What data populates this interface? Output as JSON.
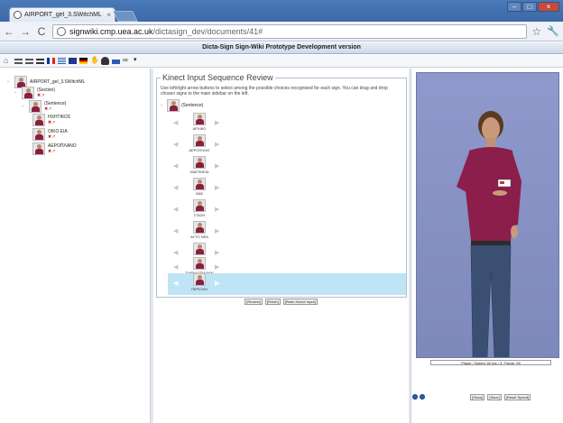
{
  "browser": {
    "tab_title": "AIRPORT_gel_3.SWitchML - Dic",
    "tab_close": "×",
    "url_host": "signwiki.cmp.uea.ac.uk",
    "url_path": "/dictasign_dev/documents/41#",
    "back": "←",
    "forward": "→",
    "reload": "C",
    "star": "☆",
    "wrench": "🔧",
    "win_min": "–",
    "win_max": "□",
    "win_close": "×"
  },
  "site": {
    "header": "Dicta-Sign Sign-Wiki Prototype Development version"
  },
  "tree": {
    "root": "AIRPORT_gel_3.SWitchML",
    "section": "(Section)",
    "sentence": "(Sentence)",
    "items": [
      "ΗΧΗΤΙΚΟΣ",
      "ΟΙΚΟ ΕΙΑ",
      "ΑΕΡΟΠΛΑΝΟ"
    ],
    "mini_icons": "✖↗"
  },
  "kinect": {
    "legend": "Kinect Input Sequence Review",
    "instructions": "Use left/right arrow buttons to select among the possible choices recognised for each sign. You can drag and drop chosen signs to the main sidebar on the left.",
    "root_label": "(Sentence)",
    "items": [
      "ΑΡΧΙΚΟ",
      "ΑΕΡΟΠΛΟΙΣ",
      "ΙΘΑΓΕΝΕΙΑ",
      "ΘΑΕ",
      "ΣΤΑΣΗ",
      "ΑΥΤΟ ΝΕΑ",
      "ΑΘΗΝΑ",
      "ΠΑΡΑΔΟΣΗ ΒΑΝ",
      "ΠΕΡΙΟΧΗ"
    ],
    "arrow_left": "◀",
    "arrow_right": "▶",
    "buttons": [
      "[Review]",
      "[Finish]",
      "[Redo Kinect Input]"
    ]
  },
  "viewer": {
    "status": "Player / Speed: 60 fps / 3. Frame: 95",
    "buttons": [
      "[Show]",
      "[Save]",
      "[Reset Speed]"
    ]
  }
}
